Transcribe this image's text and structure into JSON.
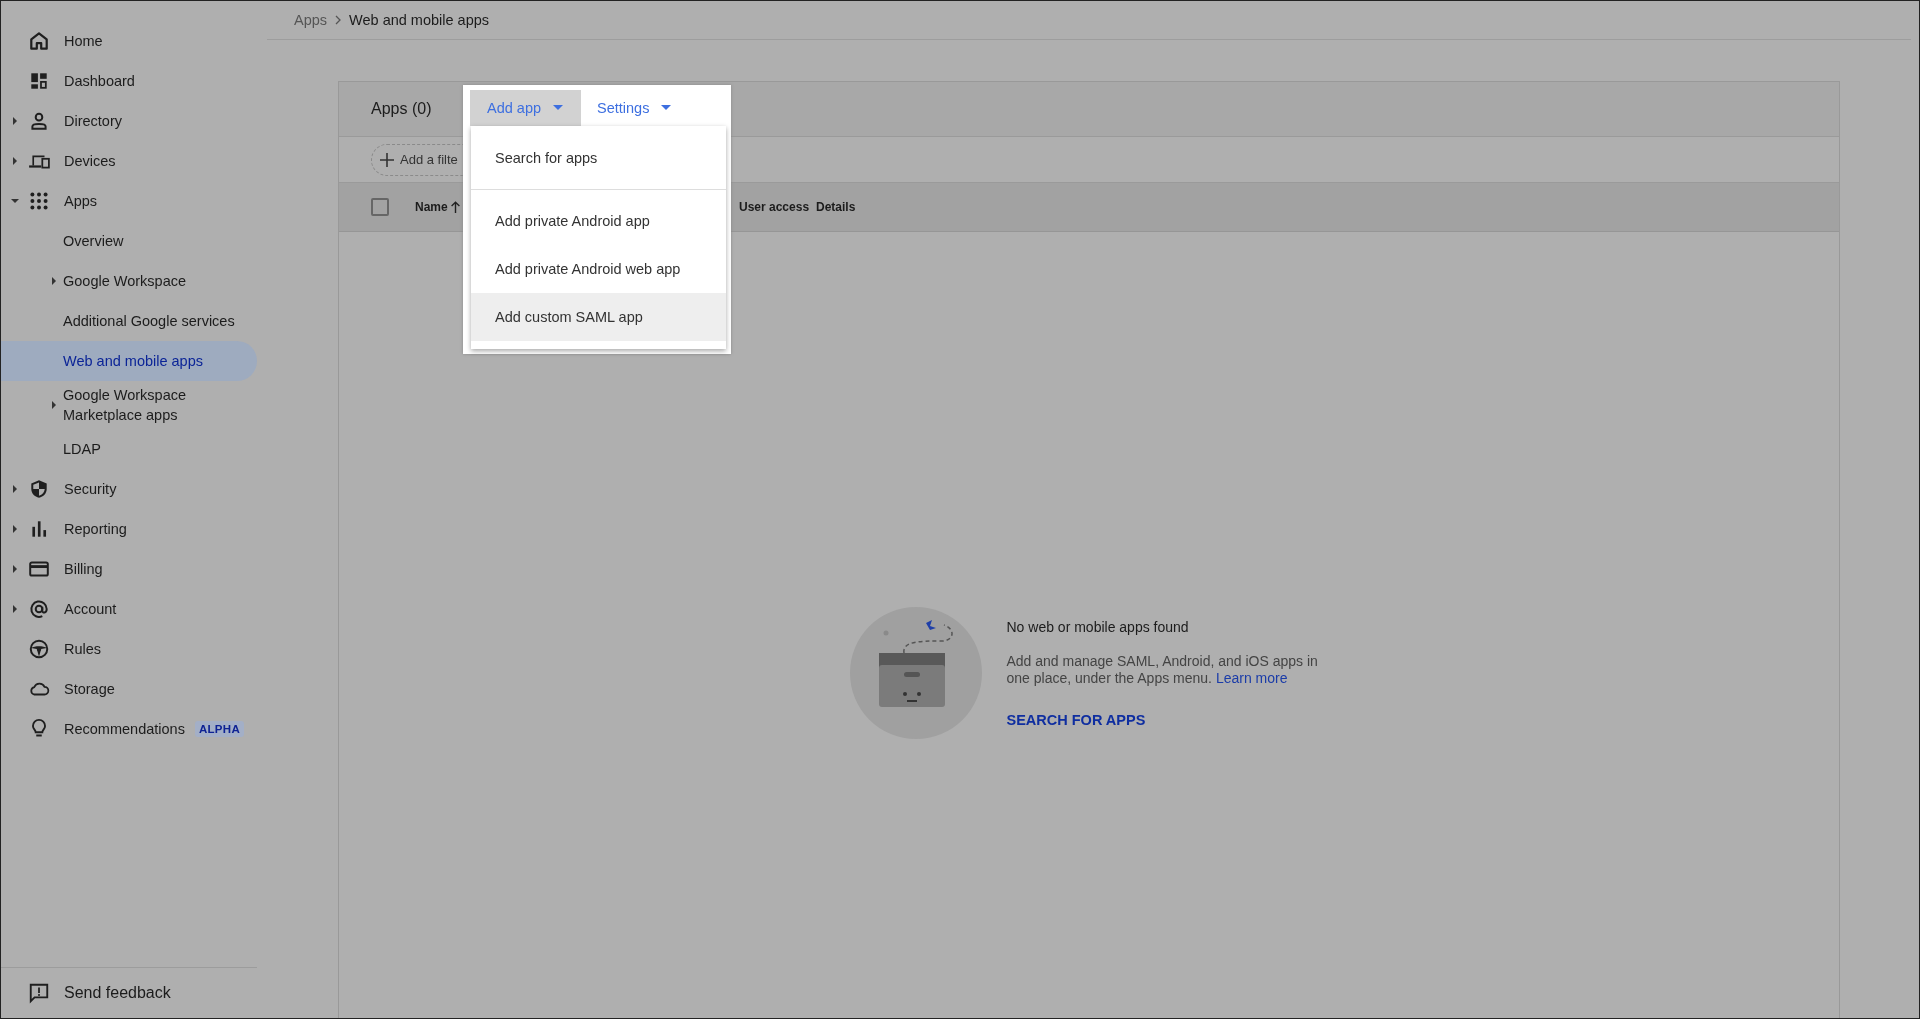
{
  "breadcrumb": [
    {
      "label": "Apps"
    },
    {
      "label": "Web and mobile apps"
    }
  ],
  "sidebar": {
    "items": [
      {
        "label": "Home",
        "selected": false
      },
      {
        "label": "Dashboard",
        "selected": false
      },
      {
        "label": "Directory",
        "selected": false,
        "expanded": false
      },
      {
        "label": "Devices",
        "selected": false,
        "expanded": false
      },
      {
        "label": "Apps",
        "selected": false,
        "expanded": true,
        "children": [
          {
            "label": "Overview",
            "selected": false
          },
          {
            "label": "Google Workspace",
            "selected": false,
            "expanded": false
          },
          {
            "label": "Additional Google services",
            "selected": false
          },
          {
            "label": "Web and mobile apps",
            "selected": true
          },
          {
            "label": "Google Workspace Marketplace apps",
            "selected": false,
            "expanded": false
          },
          {
            "label": "LDAP",
            "selected": false
          }
        ]
      },
      {
        "label": "Security",
        "selected": false,
        "expanded": false
      },
      {
        "label": "Reporting",
        "selected": false,
        "expanded": false
      },
      {
        "label": "Billing",
        "selected": false,
        "expanded": false
      },
      {
        "label": "Account",
        "selected": false,
        "expanded": false
      },
      {
        "label": "Rules",
        "selected": false
      },
      {
        "label": "Storage",
        "selected": false
      },
      {
        "label": "Recommendations",
        "selected": false,
        "badge": "ALPHA"
      }
    ],
    "footer": {
      "label": "Send feedback"
    }
  },
  "panel": {
    "title": "Apps (0)",
    "toolbar": [
      {
        "label": "Add app",
        "open": true
      },
      {
        "label": "Settings",
        "open": false
      }
    ],
    "menu": {
      "sections": [
        {
          "items": [
            {
              "label": "Search for apps",
              "hovered": false
            }
          ]
        },
        {
          "items": [
            {
              "label": "Add private Android app",
              "hovered": false
            },
            {
              "label": "Add private Android web app",
              "hovered": false
            },
            {
              "label": "Add custom SAML app",
              "hovered": true
            }
          ]
        }
      ]
    },
    "filter": {
      "label": "Add a filte"
    },
    "table": {
      "select_all": {
        "checked": false
      },
      "columns": [
        {
          "label": "Name",
          "sorted": true
        },
        {
          "label": "User access",
          "sorted": false
        },
        {
          "label": "Details",
          "sorted": false
        }
      ]
    },
    "empty_state": {
      "title": "No web or mobile apps found",
      "description": "Add and manage SAML, Android, and iOS apps in one place, under the Apps menu.",
      "link": "Learn more",
      "action": "SEARCH FOR APPS"
    }
  }
}
